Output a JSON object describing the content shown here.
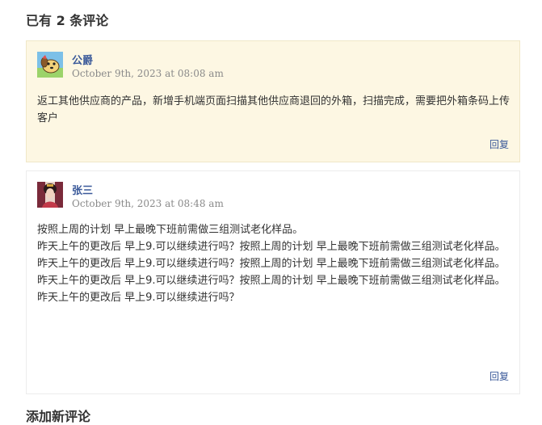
{
  "comments_heading": "已有 2 条评论",
  "comments": [
    {
      "author": "公爵",
      "avatar": "cartoon-dog-avatar",
      "date": "October 9th, 2023 at 08:08 am",
      "lines": [
        "返工其他供应商的产品，新增手机端页面扫描其他供应商退回的外箱，扫描完成，需要把外箱条码上传客户"
      ],
      "reply_label": "回复"
    },
    {
      "author": "张三",
      "avatar": "portrait-avatar",
      "date": "October 9th, 2023 at 08:48 am",
      "lines": [
        "按照上周的计划 早上最晚下班前需做三组测试老化样品。",
        "昨天上午的更改后 早上9.可以继续进行吗？按照上周的计划 早上最晚下班前需做三组测试老化样品。",
        "昨天上午的更改后 早上9.可以继续进行吗？按照上周的计划 早上最晚下班前需做三组测试老化样品。",
        "昨天上午的更改后 早上9.可以继续进行吗？按照上周的计划 早上最晚下班前需做三组测试老化样品。",
        "昨天上午的更改后 早上9.可以继续进行吗？"
      ],
      "reply_label": "回复"
    }
  ],
  "add_comment_heading": "添加新评论",
  "colors": {
    "highlight_bg": "#fdf7e3",
    "link": "#3b5a9a",
    "meta": "#8a8a8a"
  }
}
